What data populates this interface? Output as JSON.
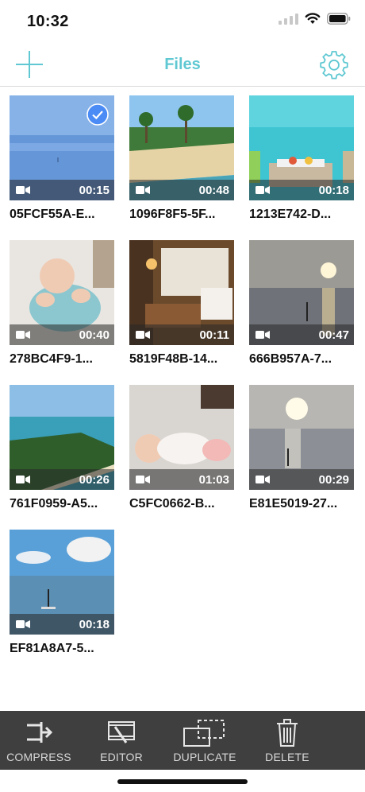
{
  "status": {
    "time": "10:32"
  },
  "nav": {
    "title": "Files",
    "add_icon": "plus-icon",
    "settings_icon": "gear-icon"
  },
  "colors": {
    "accent": "#5fc8d2",
    "toolbar": "#3f3f3f",
    "selected": "#4a8bf5"
  },
  "files": [
    {
      "name": "05FCF55A-E...",
      "duration": "00:15",
      "selected": true
    },
    {
      "name": "1096F8F5-5F...",
      "duration": "00:48",
      "selected": false
    },
    {
      "name": "1213E742-D...",
      "duration": "00:18",
      "selected": false
    },
    {
      "name": "278BC4F9-1...",
      "duration": "00:40",
      "selected": false
    },
    {
      "name": "5819F48B-14...",
      "duration": "00:11",
      "selected": false
    },
    {
      "name": "666B957A-7...",
      "duration": "00:47",
      "selected": false
    },
    {
      "name": "761F0959-A5...",
      "duration": "00:26",
      "selected": false
    },
    {
      "name": "C5FC0662-B...",
      "duration": "01:03",
      "selected": false
    },
    {
      "name": "E81E5019-27...",
      "duration": "00:29",
      "selected": false
    },
    {
      "name": "EF81A8A7-5...",
      "duration": "00:18",
      "selected": false
    }
  ],
  "toolbar": {
    "compress_label": "COMPRESS",
    "editor_label": "EDITOR",
    "duplicate_label": "DUPLICATE",
    "delete_label": "DELETE"
  }
}
